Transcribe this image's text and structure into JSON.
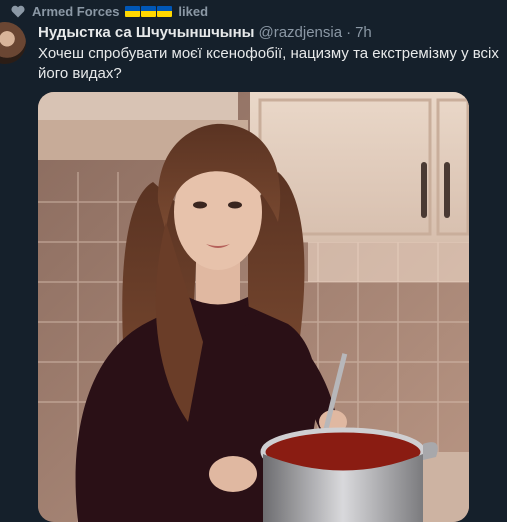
{
  "liked_banner": {
    "user": "Armed Forces",
    "flags": [
      "ua-flag",
      "ua-flag",
      "ua-flag"
    ],
    "action": "liked",
    "icon": "heart-icon"
  },
  "tweet": {
    "display_name": "Нудыстка са Шчучыншчыны",
    "handle": "@razdjensia",
    "separator": "·",
    "time": "7h",
    "text": "Хочеш спробувати моєї ксенофобії, нацизму та екстремізму у всіх його видах?",
    "media": {
      "kind": "photo",
      "description_icon": "photo-icon"
    }
  },
  "colors": {
    "background": "#15202b",
    "text": "#e7e9ea",
    "muted": "#8b98a5",
    "flag_blue": "#0057b7",
    "flag_yellow": "#ffd700"
  }
}
